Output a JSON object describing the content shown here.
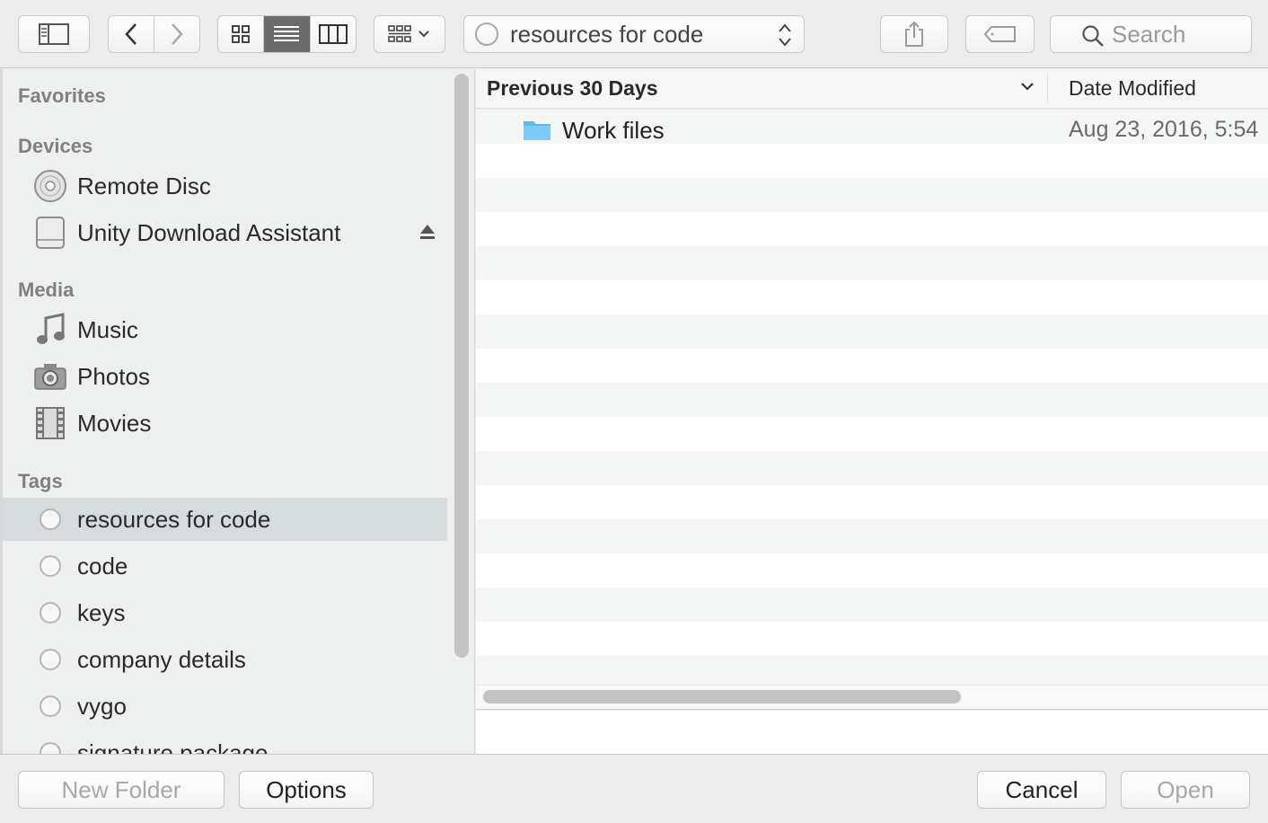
{
  "toolbar": {
    "location": "resources for code",
    "search_placeholder": "Search"
  },
  "sidebar": {
    "favorites_header": "Favorites",
    "devices_header": "Devices",
    "devices": [
      {
        "label": "Remote Disc",
        "icon": "disc-icon"
      },
      {
        "label": "Unity Download Assistant",
        "icon": "drive-icon"
      }
    ],
    "media_header": "Media",
    "media": [
      {
        "label": "Music",
        "icon": "music-note-icon"
      },
      {
        "label": "Photos",
        "icon": "camera-icon"
      },
      {
        "label": "Movies",
        "icon": "film-icon"
      }
    ],
    "tags_header": "Tags",
    "tags": [
      {
        "label": "resources for code",
        "selected": true
      },
      {
        "label": "code"
      },
      {
        "label": "keys"
      },
      {
        "label": "company details"
      },
      {
        "label": "vygo"
      },
      {
        "label": "signature package"
      }
    ]
  },
  "list": {
    "group_header": "Previous 30 Days",
    "date_header": "Date Modified",
    "files": [
      {
        "name": "Work files",
        "date": "Aug 23, 2016, 5:54",
        "icon": "folder-icon"
      }
    ]
  },
  "buttons": {
    "new_folder": "New Folder",
    "options": "Options",
    "cancel": "Cancel",
    "open": "Open"
  },
  "colors": {
    "folder": "#6cc0f2",
    "selected_row": "#d6dcdd",
    "active_segment": "#6b6b6b"
  }
}
